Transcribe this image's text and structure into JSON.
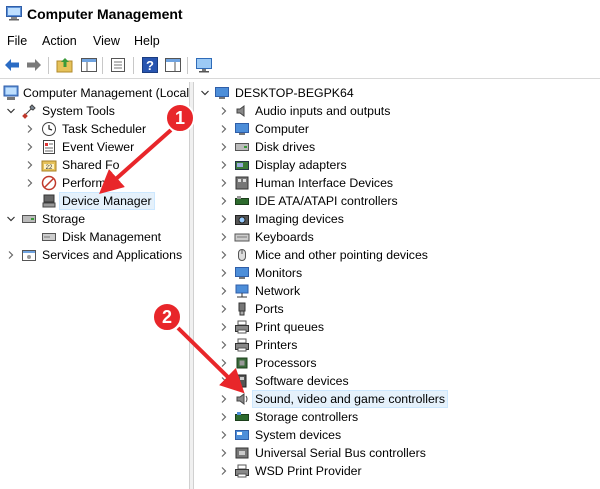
{
  "window": {
    "title": "Computer Management"
  },
  "menu": [
    "File",
    "Action",
    "View",
    "Help"
  ],
  "toolbar": {
    "icons": [
      "back-arrow-icon",
      "forward-arrow-icon",
      "up-folder-icon",
      "show-hide-tree-icon",
      "properties-icon",
      "help-icon",
      "action-pane-icon",
      "monitor-icon"
    ]
  },
  "left_tree": {
    "root": "Computer Management (Local",
    "system_tools": "System Tools",
    "task_scheduler": "Task Scheduler",
    "event_viewer": "Event Viewer",
    "shared_folders": "Shared Fo",
    "performance": "Perform",
    "device_manager": "Device Manager",
    "storage": "Storage",
    "disk_management": "Disk Management",
    "services_apps": "Services and Applications"
  },
  "device_tree": {
    "root": "DESKTOP-BEGPK64",
    "items": [
      {
        "label": "Audio inputs and outputs",
        "icon": "speaker-icon"
      },
      {
        "label": "Computer",
        "icon": "computer-icon"
      },
      {
        "label": "Disk drives",
        "icon": "disk-drive-icon"
      },
      {
        "label": "Display adapters",
        "icon": "display-adapter-icon"
      },
      {
        "label": "Human Interface Devices",
        "icon": "hid-icon"
      },
      {
        "label": "IDE ATA/ATAPI controllers",
        "icon": "ide-controller-icon"
      },
      {
        "label": "Imaging devices",
        "icon": "camera-icon"
      },
      {
        "label": "Keyboards",
        "icon": "keyboard-icon"
      },
      {
        "label": "Mice and other pointing devices",
        "icon": "mouse-icon"
      },
      {
        "label": "Monitors",
        "icon": "monitor-icon"
      },
      {
        "label": "Network",
        "icon": "network-icon"
      },
      {
        "label": "Ports",
        "icon": "port-icon"
      },
      {
        "label": "Print queues",
        "icon": "printer-icon"
      },
      {
        "label": "Printers",
        "icon": "printer-icon"
      },
      {
        "label": "Processors",
        "icon": "processor-icon"
      },
      {
        "label": "Software devices",
        "icon": "software-device-icon"
      },
      {
        "label": "Sound, video and game controllers",
        "icon": "sound-icon"
      },
      {
        "label": "Storage controllers",
        "icon": "storage-controller-icon"
      },
      {
        "label": "System devices",
        "icon": "system-device-icon"
      },
      {
        "label": "Universal Serial Bus controllers",
        "icon": "usb-icon"
      },
      {
        "label": "WSD Print Provider",
        "icon": "printer-icon"
      }
    ]
  },
  "annotations": {
    "badge_1": "1",
    "badge_2": "2",
    "color": "#e8262a"
  }
}
